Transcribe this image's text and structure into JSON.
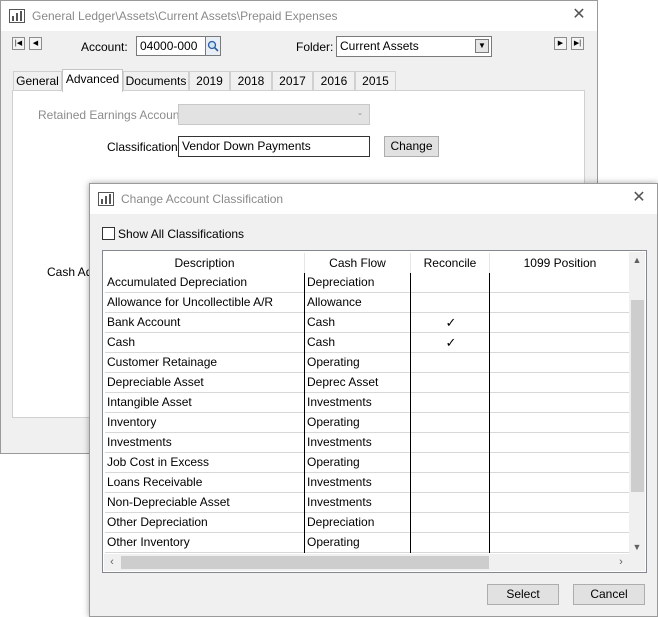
{
  "main_window": {
    "title": "General Ledger\\Assets\\Current Assets\\Prepaid Expenses",
    "account_label": "Account:",
    "account_value": "04000-000",
    "folder_label": "Folder:",
    "folder_value": "Current Assets",
    "tabs": [
      {
        "label": "General"
      },
      {
        "label": "Advanced",
        "active": true
      },
      {
        "label": "Documents"
      },
      {
        "label": "2019"
      },
      {
        "label": "2018"
      },
      {
        "label": "2017"
      },
      {
        "label": "2016"
      },
      {
        "label": "2015"
      }
    ],
    "retained_earnings_label": "Retained Earnings Account:",
    "retained_earnings_value": "",
    "classification_label": "Classification:",
    "classification_value": "Vendor Down Payments",
    "change_button": "Change",
    "cash_adj_label": "Cash Adj"
  },
  "dialog": {
    "title": "Change Account Classification",
    "show_all_label": "Show All Classifications",
    "show_all_checked": false,
    "columns": [
      "Description",
      "Cash Flow",
      "Reconcile",
      "1099 Position"
    ],
    "rows": [
      {
        "description": "Accumulated Depreciation",
        "cash_flow": "Depreciation",
        "reconcile": ""
      },
      {
        "description": "Allowance for Uncollectible A/R",
        "cash_flow": "Allowance",
        "reconcile": ""
      },
      {
        "description": "Bank Account",
        "cash_flow": "Cash",
        "reconcile": "✓"
      },
      {
        "description": "Cash",
        "cash_flow": "Cash",
        "reconcile": "✓"
      },
      {
        "description": "Customer Retainage",
        "cash_flow": "Operating",
        "reconcile": ""
      },
      {
        "description": "Depreciable Asset",
        "cash_flow": "Deprec Asset",
        "reconcile": ""
      },
      {
        "description": "Intangible Asset",
        "cash_flow": "Investments",
        "reconcile": ""
      },
      {
        "description": "Inventory",
        "cash_flow": "Operating",
        "reconcile": ""
      },
      {
        "description": "Investments",
        "cash_flow": "Investments",
        "reconcile": ""
      },
      {
        "description": "Job Cost in Excess",
        "cash_flow": "Operating",
        "reconcile": ""
      },
      {
        "description": "Loans Receivable",
        "cash_flow": "Investments",
        "reconcile": ""
      },
      {
        "description": "Non-Depreciable Asset",
        "cash_flow": "Investments",
        "reconcile": ""
      },
      {
        "description": "Other Depreciation",
        "cash_flow": "Depreciation",
        "reconcile": ""
      },
      {
        "description": "Other Inventory",
        "cash_flow": "Operating",
        "reconcile": ""
      }
    ],
    "select_button": "Select",
    "cancel_button": "Cancel"
  }
}
